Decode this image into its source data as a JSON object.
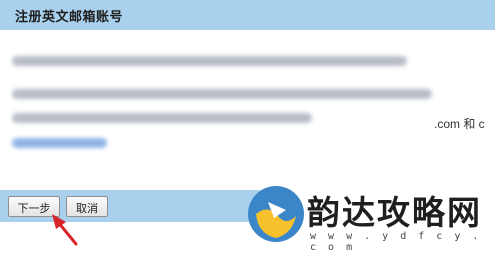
{
  "header": {
    "title": "注册英文邮箱账号"
  },
  "content": {
    "visible_text_fragment": ".com 和 c"
  },
  "footer": {
    "next_label": "下一步",
    "cancel_label": "取消"
  },
  "watermark": {
    "name": "韵达攻略网",
    "url": "w w w . y d f c y . c o m"
  },
  "colors": {
    "header_bg": "#a9d0ec",
    "arrow": "#d9262b",
    "logo_blue": "#3a86c8",
    "logo_yellow": "#f6c12b"
  }
}
